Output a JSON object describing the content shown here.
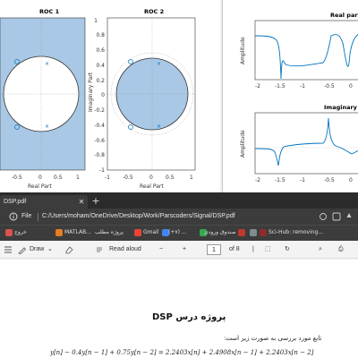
{
  "matlab": {
    "roc1": {
      "title": "ROC 1",
      "xlabel": "Real Part",
      "xticks": [
        "-0.5",
        "0",
        "0.5",
        "1"
      ]
    },
    "roc2": {
      "title": "ROC 2",
      "xlabel": "Real Part",
      "ylabel": "Imaginary Part",
      "xticks": [
        "-1",
        "-0.5",
        "0",
        "0.5",
        "1"
      ],
      "yticks": [
        "1",
        "0.8",
        "0.6",
        "0.4",
        "0.2",
        "0",
        "-0.2",
        "-0.4",
        "-0.6",
        "-0.8",
        "-1"
      ]
    },
    "real_plot": {
      "title": "Real part",
      "ylabel": "Amplitude",
      "xticks": [
        "-2",
        "-1.5",
        "-1",
        "-0.5",
        "0",
        "0.5"
      ]
    },
    "imag_plot": {
      "title": "Imaginary part",
      "ylabel": "Amplitude",
      "xticks": [
        "-2",
        "-1.5",
        "-1",
        "-0.5",
        "0",
        "0.5"
      ]
    },
    "colors": {
      "roc_fill": "#a9c8e6",
      "line": "#0072bd"
    }
  },
  "browser": {
    "tab_title": "DSP.pdf",
    "tab_close": "✕",
    "new_tab": "+",
    "address_label": "File",
    "address_url": "C:/Users/moham/OneDrive/Desktop/Work/Parscoders/Signal/DSP.pdf",
    "bookmarks": [
      "خروج",
      "MATLAB...",
      "پروژه مطلب",
      "Gmail",
      "(+۷) ...",
      "صندوق ورودی",
      "",
      "Sci-Hub: removing..."
    ],
    "pdf_toolbar": {
      "draw": "Draw",
      "read_aloud": "Read aloud",
      "page": "1",
      "of_pages": "of 8"
    }
  },
  "document": {
    "title": "پروژه درس DSP",
    "line1": "تابع مورد بررسی به صورت زیر است:",
    "equation": "y[n] − 0.4y[n − 1] + 0.75y[n − 2] = 2.2403x[n] + 2.4908x[n − 1] + 2.2403x[n − 2]"
  }
}
